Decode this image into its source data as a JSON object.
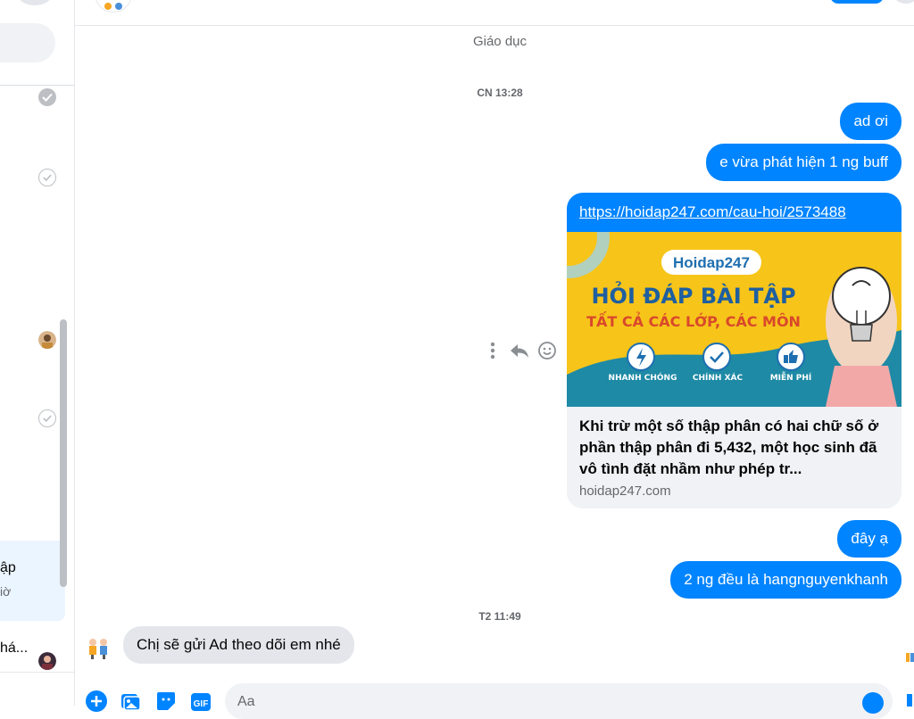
{
  "sidebar": {
    "active_item": {
      "name": "ập",
      "subtitle": "iờ"
    },
    "last_item": {
      "name": "há..."
    }
  },
  "chat": {
    "category": "Giáo dục",
    "timestamps": [
      "CN 13:28",
      "T2 11:49"
    ],
    "outgoing_messages": [
      "ad ơi",
      "e vừa phát hiện 1 ng buff",
      "đây ạ",
      "2 ng đều là hangnguyenkhanh"
    ],
    "link_preview": {
      "url": "https://hoidap247.com/cau-hoi/2573488",
      "image": {
        "brand": "Hoidap247",
        "headline": "HỎI ĐÁP BÀI TẬP",
        "subheadline": "TẤT CẢ CÁC LỚP, CÁC MÔN",
        "features": [
          "NHANH CHÓNG",
          "CHÍNH XÁC",
          "MIỄN PHÍ"
        ]
      },
      "description": "Khi trừ một số thập phân có hai chữ số ở phần thập phân đi 5,432, một học sinh đã vô tình đặt nhầm như phép tr...",
      "domain": "hoidap247.com"
    },
    "incoming_messages": [
      "Chị sẽ gửi Ad theo dõi em nhé"
    ]
  },
  "composer": {
    "placeholder": "Aa"
  },
  "colors": {
    "accent": "#0084ff",
    "bubble_in": "#e4e6eb",
    "card_yellow": "#f7c41a",
    "card_teal": "#1e8aa5"
  },
  "icons": [
    "more-vertical-icon",
    "reply-icon",
    "react-emoji-icon",
    "add-plus-icon",
    "photo-icon",
    "sticker-icon",
    "gif-icon",
    "emoji-icon"
  ]
}
